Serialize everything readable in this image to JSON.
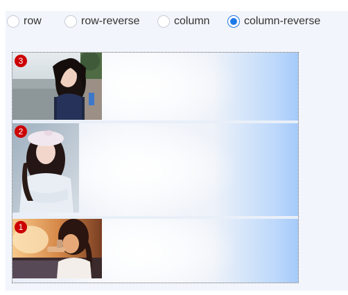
{
  "options": [
    {
      "label": "row",
      "selected": false
    },
    {
      "label": "row-reverse",
      "selected": false
    },
    {
      "label": "column",
      "selected": false
    },
    {
      "label": "column-reverse",
      "selected": true
    }
  ],
  "items": [
    {
      "number": "3",
      "photo": "woman-by-water-photo"
    },
    {
      "number": "2",
      "photo": "woman-white-beret-photo"
    },
    {
      "number": "1",
      "photo": "woman-sunset-photo"
    }
  ],
  "colors": {
    "accent": "#1e7ae8",
    "badge": "#cc0000",
    "panel": "#f2f5fb",
    "strip_edge": "#a3c9fa"
  }
}
